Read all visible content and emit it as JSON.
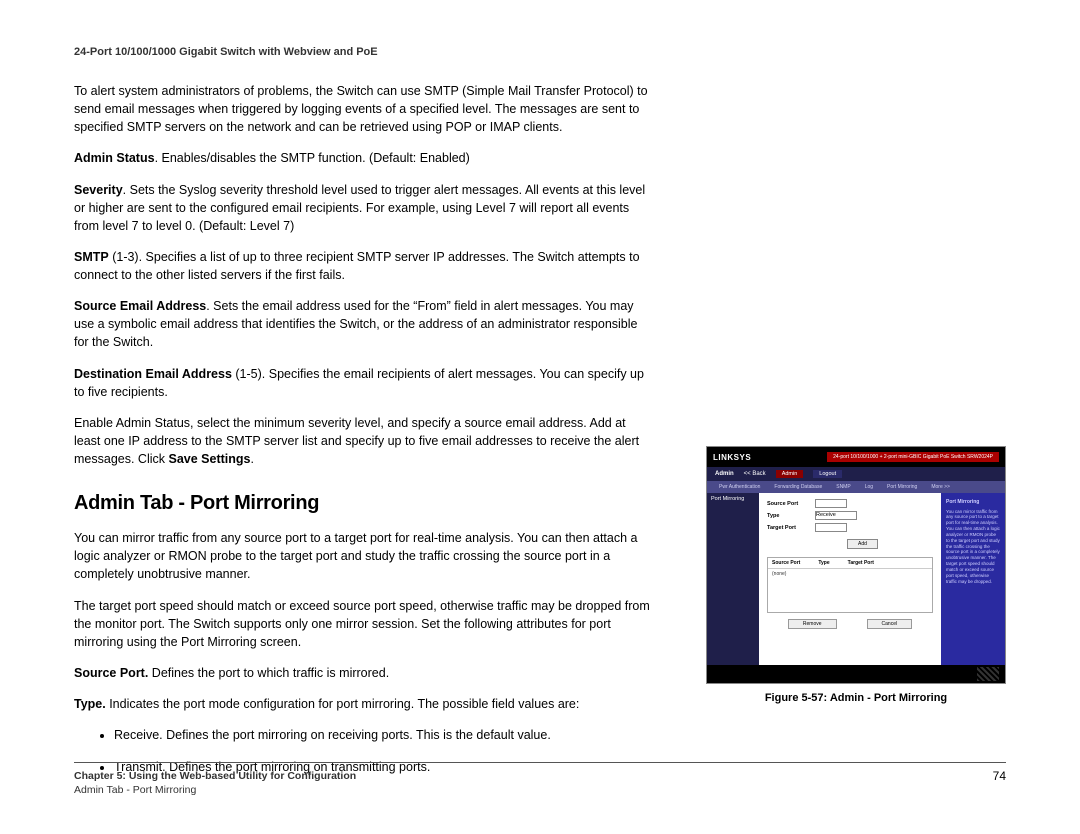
{
  "header": {
    "product": "24-Port 10/100/1000 Gigabit Switch with Webview and PoE"
  },
  "intro": "To alert system administrators of problems, the Switch can use SMTP (Simple Mail Transfer Protocol) to send email messages when triggered by logging events of a specified level. The messages are sent to specified SMTP servers on the network and can be retrieved using POP or IMAP clients.",
  "params": {
    "admin_status": {
      "label": "Admin Status",
      "text": ". Enables/disables the SMTP function. (Default: Enabled)"
    },
    "severity": {
      "label": "Severity",
      "text": ". Sets the Syslog severity threshold level used to trigger alert messages. All events at this level or higher are sent to the configured email recipients. For example, using Level 7 will report all events from level 7 to level 0. (Default: Level 7)"
    },
    "smtp": {
      "label": "SMTP",
      "text": " (1-3). Specifies a list of up to three recipient SMTP server IP addresses. The Switch attempts to connect to the other listed servers if the first fails."
    },
    "source_email": {
      "label": "Source Email Address",
      "text": ". Sets the email address used for the “From” field in alert messages. You may use a symbolic email address that identifies the Switch, or the address of an administrator responsible for the Switch."
    },
    "dest_email": {
      "label": "Destination Email Address",
      "text": " (1-5). Specifies the email recipients of alert messages. You can specify up to five recipients."
    },
    "enable_note_a": "Enable Admin Status, select the minimum severity level, and specify a source email address. Add at least one IP address to the SMTP server list and specify up to five email addresses to receive the alert messages. Click ",
    "enable_note_b": "Save Settings",
    "enable_note_c": "."
  },
  "section": {
    "heading": "Admin Tab - Port Mirroring",
    "p1": "You can mirror traffic from any source port to a target port for real-time analysis. You can then attach a logic analyzer or RMON probe to the target port and study the traffic crossing the source port in a completely unobtrusive manner.",
    "p2": "The target port speed should match or exceed source port speed, otherwise traffic may be dropped from the monitor port. The Switch supports only one mirror session. Set the following attributes for port mirroring using the Port Mirroring screen.",
    "source_port": {
      "label": "Source Port.",
      "text": " Defines the port to which traffic is mirrored."
    },
    "type_intro": {
      "label": "Type.",
      "text": " Indicates the port mode configuration for port mirroring. The possible field values are:"
    },
    "bullets": {
      "receive": {
        "label": "Receive.",
        "text": " Defines the port mirroring on receiving ports. This is the default value."
      },
      "transmit": {
        "label": "Transmit.",
        "text": " Defines the port mirroring on transmitting ports."
      }
    }
  },
  "figure": {
    "caption": "Figure 5-57: Admin - Port Mirroring",
    "logo": "LINKSYS",
    "topbar_right": "24-port 10/100/1000 + 2-port mini-GBIC Gigabit PoE Switch   SRW2024P",
    "nav1": {
      "admin": "Admin",
      "back": "<< Back",
      "tab_admin": "Admin",
      "tab_logout": "Logout"
    },
    "nav2": [
      "Pwr Authentication",
      "Forwarding Database",
      "SNMP",
      "Log",
      "Port Mirroring",
      "More >>"
    ],
    "left_label": "Port Mirroring",
    "rows": {
      "source_port": "Source Port",
      "type": "Type",
      "target_port": "Target Port",
      "type_value": "Receive"
    },
    "add": "Add",
    "table_head": [
      "Source Port",
      "Type",
      "Target Port"
    ],
    "table_row": "(none)",
    "buttons": {
      "remove": "Remove",
      "cancel": "Cancel"
    },
    "help": {
      "title": "Port Mirroring",
      "body": "You can mirror traffic from any source port to a target port for real-time analysis. You can then attach a logic analyzer or RMON probe to the target port and study the traffic crossing the source port in a completely unobtrusive manner. The target port speed should match or exceed source port speed, otherwise traffic may be dropped."
    }
  },
  "footer": {
    "chapter": "Chapter 5: Using the Web-based Utility for Configuration",
    "sub": "Admin Tab - Port Mirroring",
    "page": "74"
  }
}
